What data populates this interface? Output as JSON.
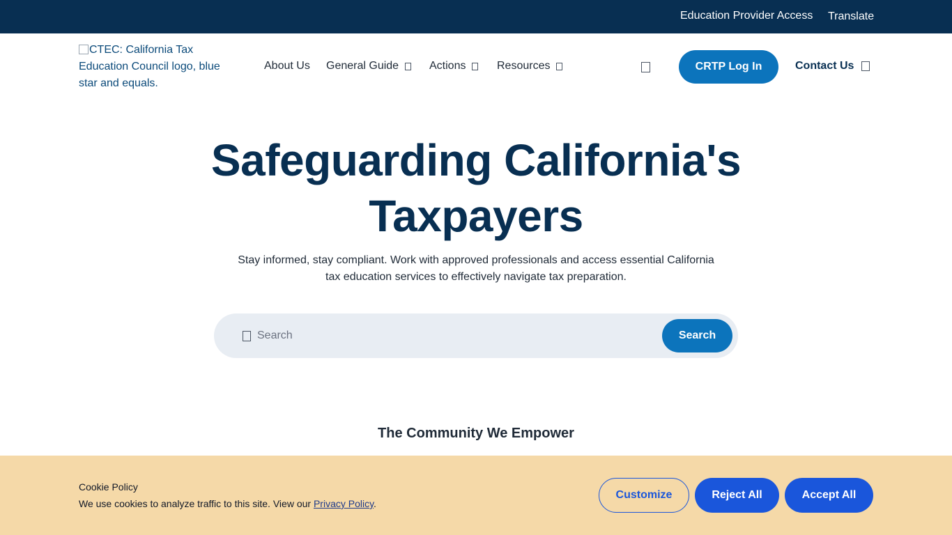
{
  "topbar": {
    "provider_access": "Education Provider Access",
    "translate": "Translate"
  },
  "logo": {
    "alt": "CTEC: California Tax Education Council logo, blue star and equals."
  },
  "nav": {
    "items": [
      {
        "label": "About Us"
      },
      {
        "label": "General Guide"
      },
      {
        "label": "Actions"
      },
      {
        "label": "Resources"
      }
    ],
    "login_label": "CRTP Log In",
    "contact_label": "Contact Us"
  },
  "hero": {
    "title": "Safeguarding California's Taxpayers",
    "subtitle": "Stay informed, stay compliant. Work with approved professionals and access essential California tax education services to effectively navigate tax preparation."
  },
  "search": {
    "placeholder": "Search",
    "button_label": "Search"
  },
  "community": {
    "heading": "The Community We Empower"
  },
  "cookie": {
    "title": "Cookie Policy",
    "text": "We use cookies to analyze traffic to this site. View our",
    "link_label": "Privacy Policy",
    "text_end": ".",
    "customize_label": "Customize",
    "reject_label": "Reject All",
    "accept_label": "Accept All"
  },
  "colors": {
    "topbar_bg": "#082f52",
    "primary_blue": "#0c74bc",
    "heading_navy": "#082f52",
    "cookie_bg": "#f5d9a8",
    "cookie_button_blue": "#1a56db",
    "search_bg": "#e8edf3"
  },
  "icons": {
    "dropdown": "chevron-down-icon",
    "search": "search-icon",
    "contact": "arrow-icon"
  }
}
